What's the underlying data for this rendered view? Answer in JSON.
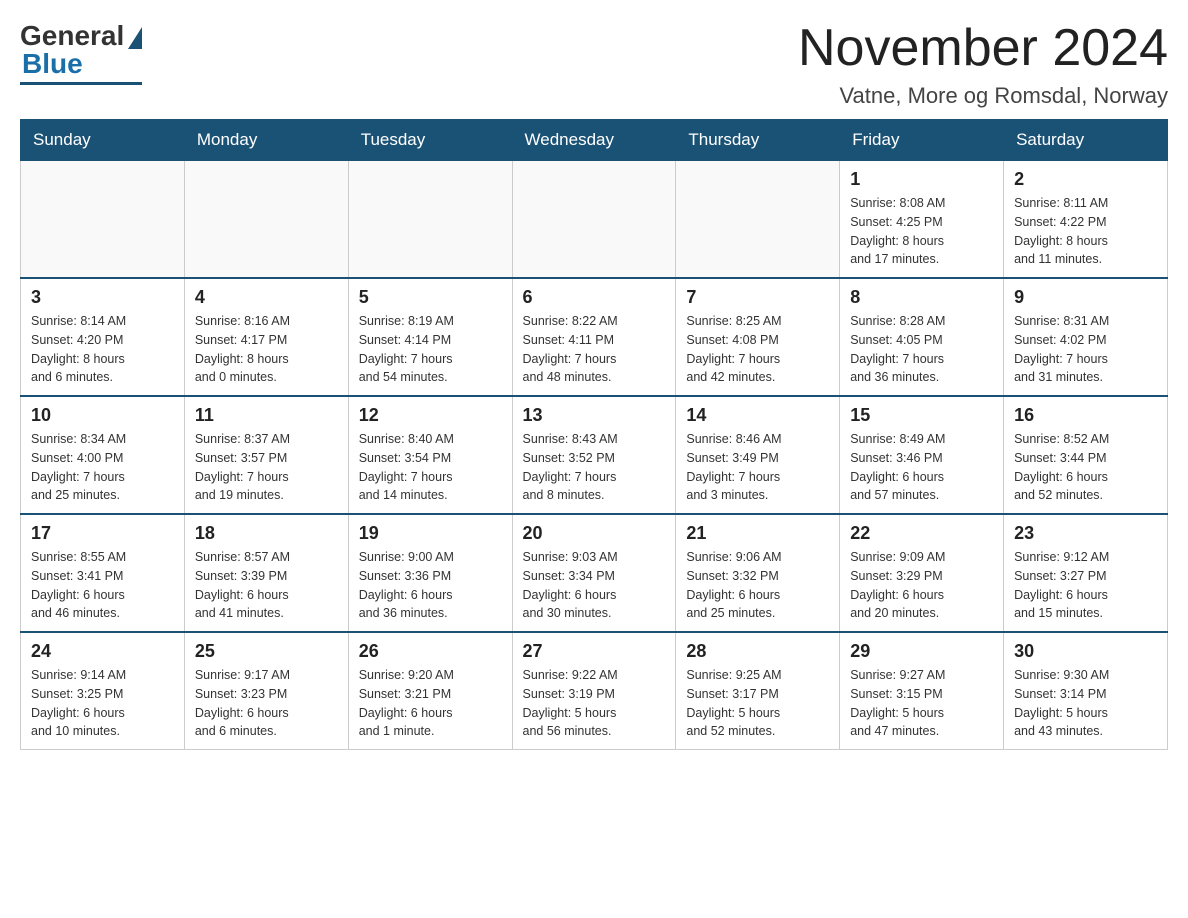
{
  "logo": {
    "general": "General",
    "blue": "Blue"
  },
  "header": {
    "title": "November 2024",
    "subtitle": "Vatne, More og Romsdal, Norway"
  },
  "weekdays": [
    "Sunday",
    "Monday",
    "Tuesday",
    "Wednesday",
    "Thursday",
    "Friday",
    "Saturday"
  ],
  "weeks": [
    [
      {
        "day": "",
        "info": ""
      },
      {
        "day": "",
        "info": ""
      },
      {
        "day": "",
        "info": ""
      },
      {
        "day": "",
        "info": ""
      },
      {
        "day": "",
        "info": ""
      },
      {
        "day": "1",
        "info": "Sunrise: 8:08 AM\nSunset: 4:25 PM\nDaylight: 8 hours\nand 17 minutes."
      },
      {
        "day": "2",
        "info": "Sunrise: 8:11 AM\nSunset: 4:22 PM\nDaylight: 8 hours\nand 11 minutes."
      }
    ],
    [
      {
        "day": "3",
        "info": "Sunrise: 8:14 AM\nSunset: 4:20 PM\nDaylight: 8 hours\nand 6 minutes."
      },
      {
        "day": "4",
        "info": "Sunrise: 8:16 AM\nSunset: 4:17 PM\nDaylight: 8 hours\nand 0 minutes."
      },
      {
        "day": "5",
        "info": "Sunrise: 8:19 AM\nSunset: 4:14 PM\nDaylight: 7 hours\nand 54 minutes."
      },
      {
        "day": "6",
        "info": "Sunrise: 8:22 AM\nSunset: 4:11 PM\nDaylight: 7 hours\nand 48 minutes."
      },
      {
        "day": "7",
        "info": "Sunrise: 8:25 AM\nSunset: 4:08 PM\nDaylight: 7 hours\nand 42 minutes."
      },
      {
        "day": "8",
        "info": "Sunrise: 8:28 AM\nSunset: 4:05 PM\nDaylight: 7 hours\nand 36 minutes."
      },
      {
        "day": "9",
        "info": "Sunrise: 8:31 AM\nSunset: 4:02 PM\nDaylight: 7 hours\nand 31 minutes."
      }
    ],
    [
      {
        "day": "10",
        "info": "Sunrise: 8:34 AM\nSunset: 4:00 PM\nDaylight: 7 hours\nand 25 minutes."
      },
      {
        "day": "11",
        "info": "Sunrise: 8:37 AM\nSunset: 3:57 PM\nDaylight: 7 hours\nand 19 minutes."
      },
      {
        "day": "12",
        "info": "Sunrise: 8:40 AM\nSunset: 3:54 PM\nDaylight: 7 hours\nand 14 minutes."
      },
      {
        "day": "13",
        "info": "Sunrise: 8:43 AM\nSunset: 3:52 PM\nDaylight: 7 hours\nand 8 minutes."
      },
      {
        "day": "14",
        "info": "Sunrise: 8:46 AM\nSunset: 3:49 PM\nDaylight: 7 hours\nand 3 minutes."
      },
      {
        "day": "15",
        "info": "Sunrise: 8:49 AM\nSunset: 3:46 PM\nDaylight: 6 hours\nand 57 minutes."
      },
      {
        "day": "16",
        "info": "Sunrise: 8:52 AM\nSunset: 3:44 PM\nDaylight: 6 hours\nand 52 minutes."
      }
    ],
    [
      {
        "day": "17",
        "info": "Sunrise: 8:55 AM\nSunset: 3:41 PM\nDaylight: 6 hours\nand 46 minutes."
      },
      {
        "day": "18",
        "info": "Sunrise: 8:57 AM\nSunset: 3:39 PM\nDaylight: 6 hours\nand 41 minutes."
      },
      {
        "day": "19",
        "info": "Sunrise: 9:00 AM\nSunset: 3:36 PM\nDaylight: 6 hours\nand 36 minutes."
      },
      {
        "day": "20",
        "info": "Sunrise: 9:03 AM\nSunset: 3:34 PM\nDaylight: 6 hours\nand 30 minutes."
      },
      {
        "day": "21",
        "info": "Sunrise: 9:06 AM\nSunset: 3:32 PM\nDaylight: 6 hours\nand 25 minutes."
      },
      {
        "day": "22",
        "info": "Sunrise: 9:09 AM\nSunset: 3:29 PM\nDaylight: 6 hours\nand 20 minutes."
      },
      {
        "day": "23",
        "info": "Sunrise: 9:12 AM\nSunset: 3:27 PM\nDaylight: 6 hours\nand 15 minutes."
      }
    ],
    [
      {
        "day": "24",
        "info": "Sunrise: 9:14 AM\nSunset: 3:25 PM\nDaylight: 6 hours\nand 10 minutes."
      },
      {
        "day": "25",
        "info": "Sunrise: 9:17 AM\nSunset: 3:23 PM\nDaylight: 6 hours\nand 6 minutes."
      },
      {
        "day": "26",
        "info": "Sunrise: 9:20 AM\nSunset: 3:21 PM\nDaylight: 6 hours\nand 1 minute."
      },
      {
        "day": "27",
        "info": "Sunrise: 9:22 AM\nSunset: 3:19 PM\nDaylight: 5 hours\nand 56 minutes."
      },
      {
        "day": "28",
        "info": "Sunrise: 9:25 AM\nSunset: 3:17 PM\nDaylight: 5 hours\nand 52 minutes."
      },
      {
        "day": "29",
        "info": "Sunrise: 9:27 AM\nSunset: 3:15 PM\nDaylight: 5 hours\nand 47 minutes."
      },
      {
        "day": "30",
        "info": "Sunrise: 9:30 AM\nSunset: 3:14 PM\nDaylight: 5 hours\nand 43 minutes."
      }
    ]
  ]
}
